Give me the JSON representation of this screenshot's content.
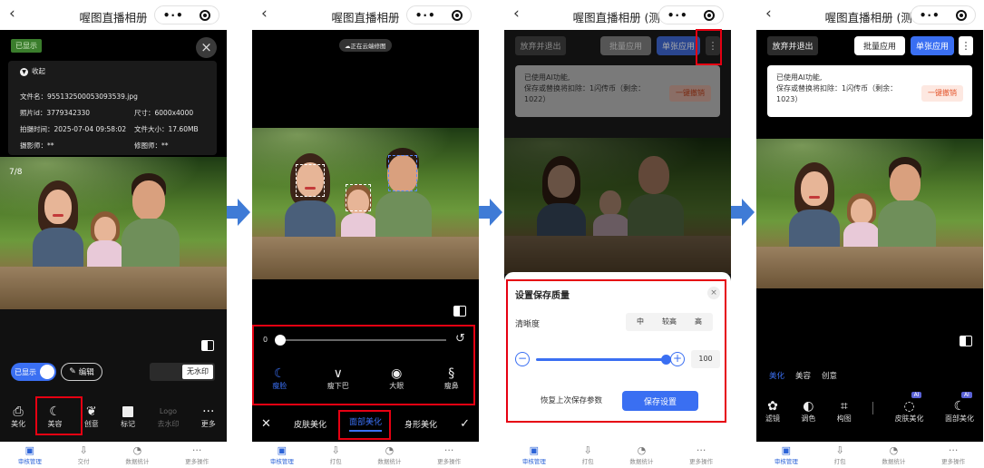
{
  "panel1": {
    "title": "喔图直播相册",
    "shown_badge": "已显示",
    "collapse": "收起",
    "file_name": "文件名：9551325000530935‌39.jpg",
    "photo_id": "照片id：3779342330",
    "size": "尺寸：6000x4000",
    "shot_time": "拍摄时间：2025-07-04 09:58:02",
    "file_size": "文件大小：17.60MB",
    "photographer": "摄影师：**",
    "retoucher": "修图师：**",
    "counter": "7/8",
    "toggle_label": "已显示",
    "edit_label": "编辑",
    "watermark_label": "无水印",
    "tools": [
      {
        "label": "美化",
        "icon": "beautify-icon"
      },
      {
        "label": "美容",
        "icon": "beauty-icon"
      },
      {
        "label": "创意",
        "icon": "creative-icon"
      },
      {
        "label": "标记",
        "icon": "mark-icon"
      },
      {
        "label": "去水印",
        "icon": "logo-icon",
        "glyph": "Logo"
      },
      {
        "label": "更多",
        "icon": "more-icon"
      }
    ],
    "tabbar": [
      "审核管理",
      "交付",
      "数据统计",
      "更多操作"
    ]
  },
  "panel2": {
    "cloud_badge": "正在云端修图",
    "slider_value": "0",
    "face_tools": [
      "瘦脸",
      "瘦下巴",
      "大眼",
      "瘦鼻"
    ],
    "categories": [
      "皮肤美化",
      "面部美化",
      "身形美化"
    ],
    "tabbar": [
      "审核管理",
      "打包",
      "数据统计",
      "更多操作"
    ]
  },
  "panel3": {
    "title": "喔图直播相册 (测…",
    "discard": "放弃并退出",
    "batch": "批量应用",
    "single": "单张应用",
    "notice_line1": "已使用AI功能,",
    "notice_line2": "保存或替换将扣除：1闪传币（剩余：",
    "notice_line3": "1022）",
    "undo": "一键撤销",
    "sheet_title": "设置保存质量",
    "clarity_label": "清晰度",
    "clarity_options": [
      "中",
      "较高",
      "高"
    ],
    "quality_value": "100",
    "restore_btn": "恢复上次保存参数",
    "save_btn": "保存设置",
    "tabbar": [
      "审核管理",
      "打包",
      "数据统计",
      "更多操作"
    ]
  },
  "panel4": {
    "title": "喔图直播相册 (测…",
    "discard": "放弃并退出",
    "batch": "批量应用",
    "single": "单张应用",
    "notice_line1": "已使用AI功能,",
    "notice_line2": "保存或替换将扣除：1闪传币（剩余：",
    "notice_line3": "1023）",
    "undo": "一键撤销",
    "subtabs": [
      "美化",
      "美容",
      "创意"
    ],
    "tools": [
      {
        "label": "滤镜",
        "icon": "filter-icon"
      },
      {
        "label": "调色",
        "icon": "palette-icon"
      },
      {
        "label": "构图",
        "icon": "crop-icon"
      },
      {
        "label": "皮肤美化",
        "icon": "skin-icon",
        "badge": "AI"
      },
      {
        "label": "面部美化",
        "icon": "face-icon",
        "badge": "AI"
      }
    ],
    "tabbar": [
      "审核管理",
      "打包",
      "数据统计",
      "更多操作"
    ]
  },
  "colors": {
    "accent": "#3a6ff2",
    "highlight": "#e60012",
    "arrow": "#3f7bd6"
  }
}
